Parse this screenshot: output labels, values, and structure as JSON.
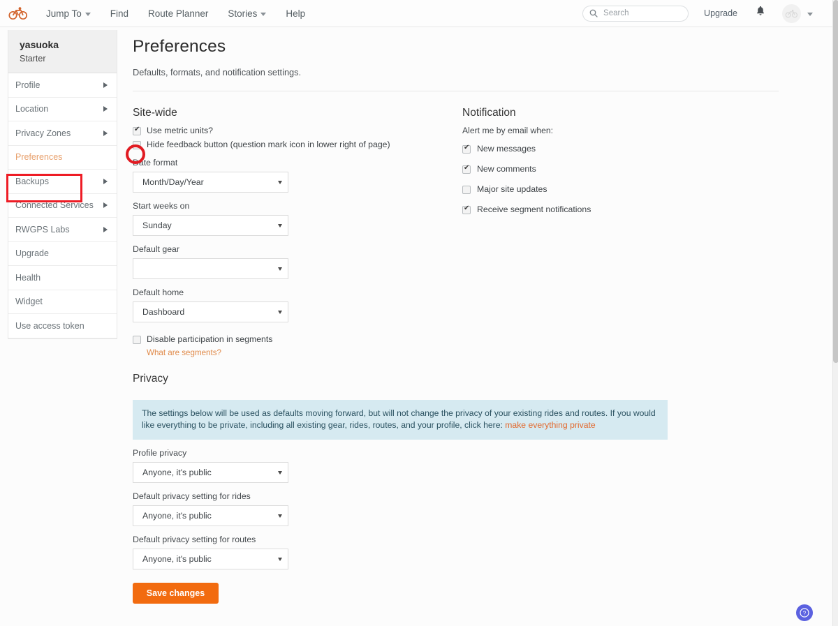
{
  "navbar": {
    "logo_icon": "bicycle-logo-icon",
    "links": [
      {
        "label": "Jump To",
        "has_caret": true
      },
      {
        "label": "Find",
        "has_caret": false
      },
      {
        "label": "Route Planner",
        "has_caret": false
      },
      {
        "label": "Stories",
        "has_caret": true
      },
      {
        "label": "Help",
        "has_caret": false
      }
    ],
    "search": {
      "placeholder": "Search",
      "value": "",
      "icon": "search-icon"
    },
    "upgrade_label": "Upgrade",
    "bell_icon": "notification-bell-icon",
    "avatar_icon": "user-avatar-bicycle-icon"
  },
  "sidebar": {
    "username": "yasuoka",
    "plan": "Starter",
    "items": [
      {
        "label": "Profile",
        "chevron": true,
        "active": false
      },
      {
        "label": "Location",
        "chevron": true,
        "active": false
      },
      {
        "label": "Privacy Zones",
        "chevron": true,
        "active": false
      },
      {
        "label": "Preferences",
        "chevron": false,
        "active": true
      },
      {
        "label": "Backups",
        "chevron": true,
        "active": false
      },
      {
        "label": "Connected Services",
        "chevron": true,
        "active": false
      },
      {
        "label": "RWGPS Labs",
        "chevron": true,
        "active": false
      },
      {
        "label": "Upgrade",
        "chevron": false,
        "active": false
      },
      {
        "label": "Health",
        "chevron": false,
        "active": false
      },
      {
        "label": "Widget",
        "chevron": false,
        "active": false
      },
      {
        "label": "Use access token",
        "chevron": false,
        "active": false
      }
    ]
  },
  "main": {
    "title": "Preferences",
    "subtitle": "Defaults, formats, and notification settings.",
    "sitewide": {
      "heading": "Site-wide",
      "checkboxes": [
        {
          "label": "Use metric units?",
          "checked": true
        },
        {
          "label": "Hide feedback button (question mark icon in lower right of page)",
          "checked": false
        }
      ],
      "fields": [
        {
          "label": "Date format",
          "value": "Month/Day/Year"
        },
        {
          "label": "Start weeks on",
          "value": "Sunday"
        },
        {
          "label": "Default gear",
          "value": ""
        },
        {
          "label": "Default home",
          "value": "Dashboard"
        }
      ],
      "segments": {
        "checkbox_label": "Disable participation in segments",
        "checked": false,
        "link_label": "What are segments?"
      }
    },
    "privacy": {
      "heading": "Privacy",
      "notice_text": "The settings below will be used as defaults moving forward, but will not change the privacy of your existing rides and routes. If you would like everything to be private, including all existing gear, rides, routes, and your profile, click here: ",
      "notice_link": "make everything private",
      "fields": [
        {
          "label": "Profile privacy",
          "value": "Anyone, it's public"
        },
        {
          "label": "Default privacy setting for rides",
          "value": "Anyone, it's public"
        },
        {
          "label": "Default privacy setting for routes",
          "value": "Anyone, it's public"
        }
      ],
      "save_label": "Save changes"
    },
    "notification": {
      "heading": "Notification",
      "subtitle": "Alert me by email when:",
      "checkboxes": [
        {
          "label": "New messages",
          "checked": true
        },
        {
          "label": "New comments",
          "checked": true
        },
        {
          "label": "Major site updates",
          "checked": false
        },
        {
          "label": "Receive segment notifications",
          "checked": true
        }
      ]
    }
  },
  "help_fab": {
    "icon": "question-mark-circle-icon"
  },
  "annotations": {
    "highlight_box_target": "Preferences",
    "highlight_circle_target": "Use metric units? checkbox",
    "color": "#ee1c25"
  },
  "colors": {
    "brand_orange": "#f26b0f",
    "link_orange": "#e08948",
    "notice_bg": "#d6eaf1",
    "help_purple": "#5b61e0"
  }
}
